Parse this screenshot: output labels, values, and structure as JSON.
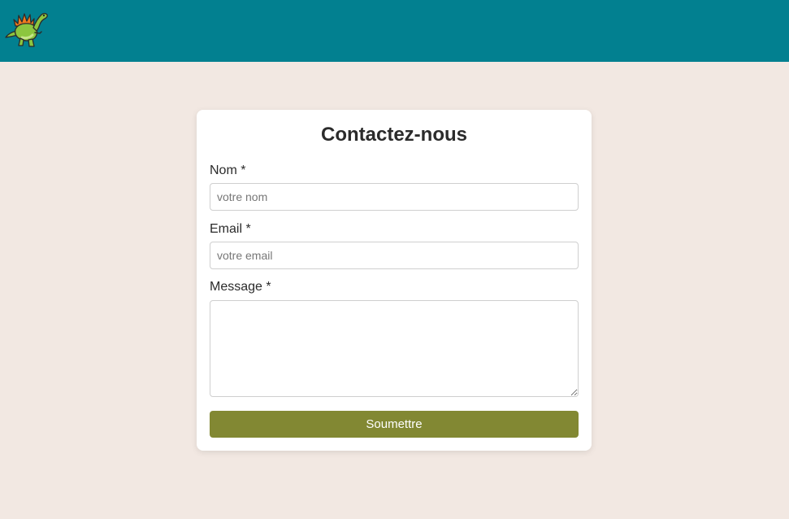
{
  "header": {
    "logo_icon": "dinosaur-icon",
    "background_color": "#028090"
  },
  "form": {
    "title": "Contactez-nous",
    "name_label": "Nom *",
    "name_placeholder": "votre nom",
    "email_label": "Email *",
    "email_placeholder": "votre email",
    "message_label": "Message *",
    "message_value": "",
    "submit_label": "Soumettre",
    "submit_color": "#828833"
  },
  "page_background": "#f2e8e2"
}
